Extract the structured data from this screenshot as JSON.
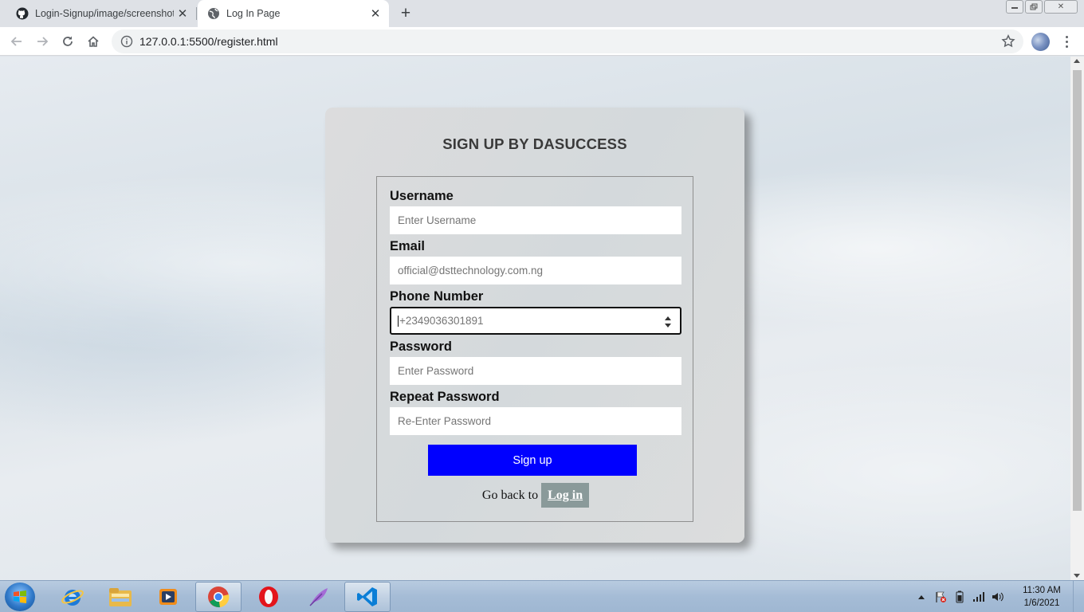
{
  "browser": {
    "tabs": [
      {
        "title": "Login-Signup/image/screenshot",
        "favicon": "github-icon",
        "active": false
      },
      {
        "title": "Log In Page",
        "favicon": "globe-icon",
        "active": true
      }
    ],
    "url": "127.0.0.1:5500/register.html"
  },
  "form": {
    "title": "SIGN UP BY DASUCCESS",
    "fields": [
      {
        "label": "Username",
        "placeholder": "Enter Username"
      },
      {
        "label": "Email",
        "placeholder": "official@dsttechnology.com.ng"
      },
      {
        "label": "Phone Number",
        "placeholder": "+2349036301891"
      },
      {
        "label": "Password",
        "placeholder": "Enter Password"
      },
      {
        "label": "Repeat Password",
        "placeholder": "Re-Enter Password"
      }
    ],
    "submit_label": "Sign up",
    "back_prefix": "Go back to",
    "login_link": "Log in",
    "colors": {
      "submit_bg": "#0000ff",
      "login_link_bg": "#8a9a9a"
    }
  },
  "taskbar": {
    "apps": [
      "internet-explorer-icon",
      "file-explorer-icon",
      "media-player-icon",
      "chrome-icon",
      "opera-icon",
      "feather-app-icon",
      "vscode-icon"
    ],
    "clock": {
      "time": "11:30 AM",
      "date": "1/6/2021"
    }
  }
}
